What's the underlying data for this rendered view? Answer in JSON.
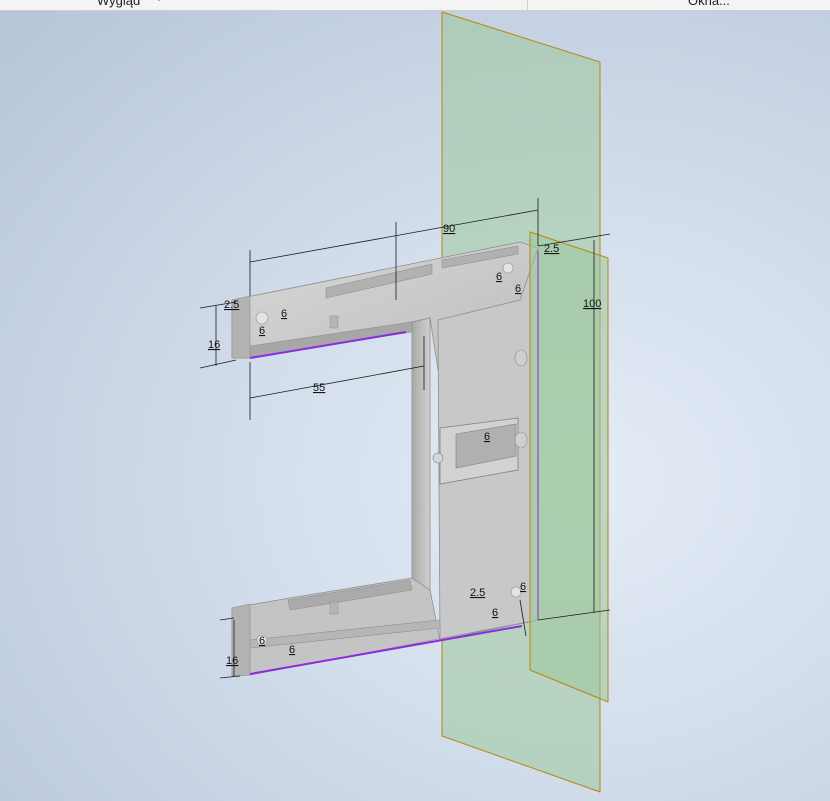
{
  "ribbon": {
    "panel_appearance": "Wygląd",
    "panel_windows": "Okna..."
  },
  "dimensions": {
    "overall_width": "90",
    "inner_width": "55",
    "height": "100",
    "rail_height_top": "16",
    "rail_height_bottom": "16",
    "offset_top_left": "2.5",
    "offset_top_right": "2.5",
    "offset_bottom_right": "2.5",
    "hole_top_left_a": "6",
    "hole_top_left_b": "6",
    "hole_top_right_a": "6",
    "hole_top_right_b": "6",
    "bracket": "6",
    "hole_bottom_right_a": "6",
    "hole_bottom_right_b": "6",
    "hole_bottom_left_a": "6",
    "hole_bottom_left_b": "6"
  },
  "colors": {
    "work_plane": "#9cc79a",
    "work_plane_edge": "#b8860b",
    "part_face": "#c9c9c9",
    "highlight_edge": "#8a2be2",
    "background": "#d3deec"
  }
}
